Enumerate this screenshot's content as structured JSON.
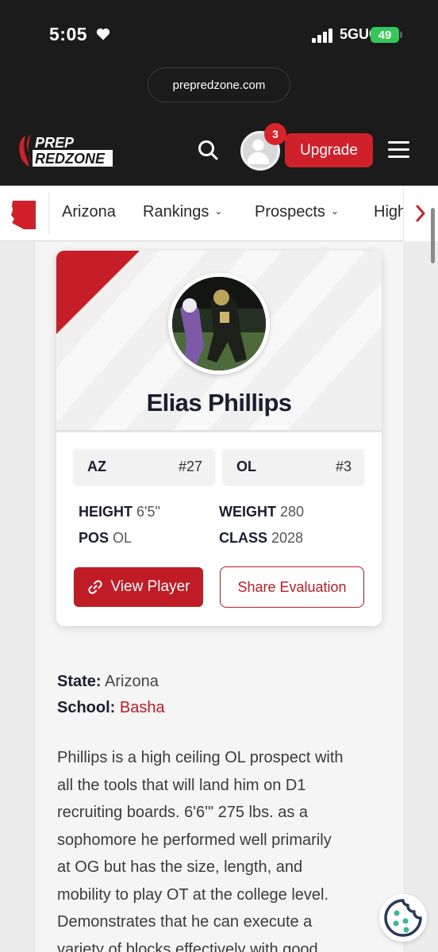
{
  "status_bar": {
    "time": "5:05",
    "network": "5GUC",
    "battery": "49"
  },
  "browser": {
    "url": "prepredzone.com"
  },
  "header": {
    "logo_line1": "PREP",
    "logo_line2": "REDZONE",
    "notification_count": "3",
    "upgrade_label": "Upgrade"
  },
  "nav": {
    "items": [
      {
        "label": "Arizona"
      },
      {
        "label": "Rankings"
      },
      {
        "label": "Prospects"
      },
      {
        "label": "High"
      }
    ]
  },
  "player": {
    "name": "Elias Phillips",
    "state_abbr": "AZ",
    "state_rank": "#27",
    "position_abbr": "OL",
    "position_rank": "#3",
    "height_label": "HEIGHT",
    "height": "6'5\"",
    "weight_label": "WEIGHT",
    "weight": "280",
    "pos_label": "POS",
    "pos": "OL",
    "class_label": "CLASS",
    "class": "2028",
    "view_button": "View Player",
    "share_button": "Share Evaluation"
  },
  "details": {
    "state_label": "State:",
    "state": "Arizona",
    "school_label": "School:",
    "school": "Basha"
  },
  "evaluation": [
    "Phillips is a high ceiling OL prospect with",
    "all the tools that will land him on D1",
    "recruiting boards. 6'6'\" 275 lbs. as a",
    "sophomore he performed well primarily",
    "at OG but has the size, length, and",
    "mobility to play OT at the college level.",
    "Demonstrates that he can execute a",
    "variety of blocks effectively with good"
  ],
  "colors": {
    "brand_red": "#c01c25",
    "dark": "#1b1b1b"
  }
}
